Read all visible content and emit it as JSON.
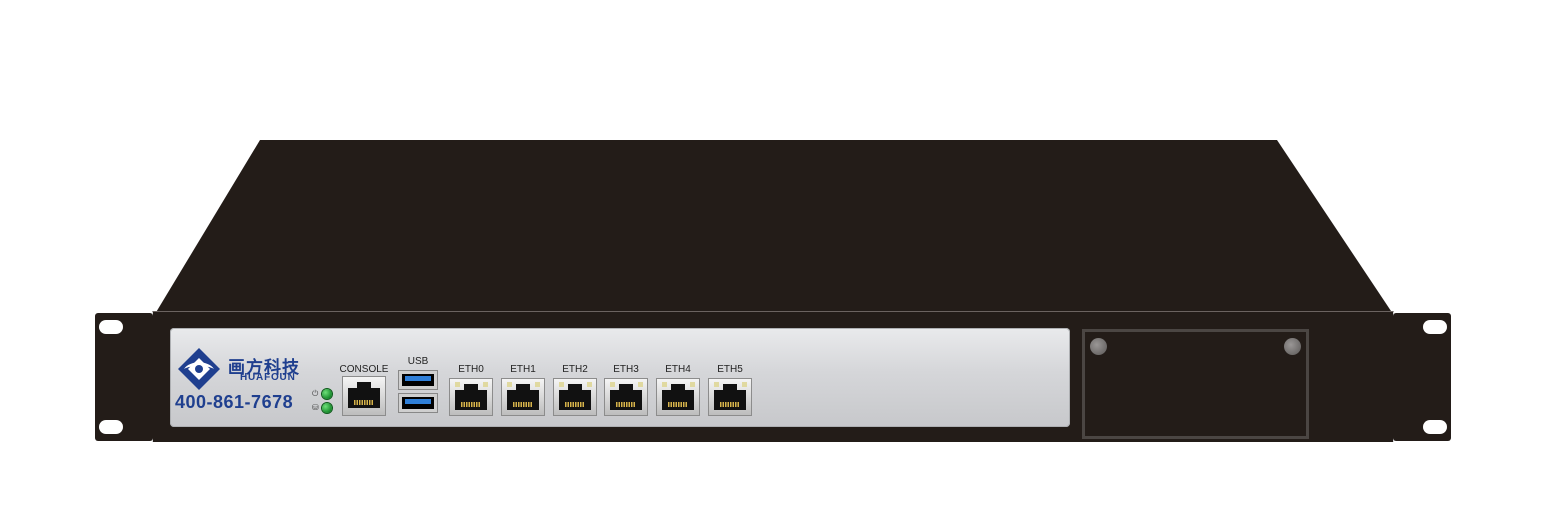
{
  "device": {
    "brand_cn": "画方科技",
    "brand_en": "HUAFOUN",
    "phone": "400-861-7678",
    "colors": {
      "chassis": "#231c18",
      "faceplate": "#d5d6d9",
      "brand_blue": "#1f3f8f",
      "led_green": "#2bb04a",
      "usb_blue": "#2f7fd8"
    },
    "ports": {
      "console": "CONSOLE",
      "usb": "USB",
      "eth": [
        "ETH0",
        "ETH1",
        "ETH2",
        "ETH3",
        "ETH4",
        "ETH5"
      ]
    },
    "leds": [
      {
        "name": "power-led",
        "symbol": "⏻"
      },
      {
        "name": "disk-led",
        "symbol": "⛁"
      }
    ]
  }
}
